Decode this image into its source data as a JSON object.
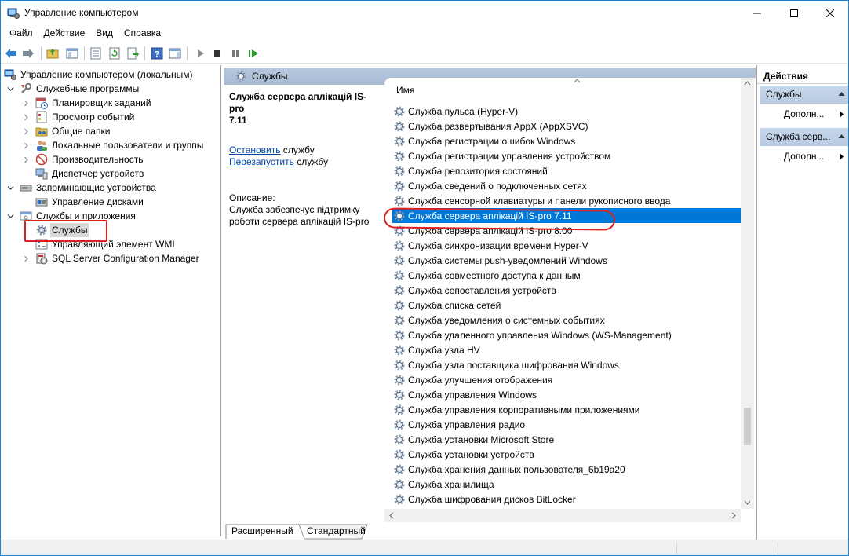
{
  "window": {
    "title": "Управление компьютером"
  },
  "menu": [
    "Файл",
    "Действие",
    "Вид",
    "Справка"
  ],
  "tree": {
    "root": "Управление компьютером (локальным)",
    "items": [
      {
        "label": "Служебные программы"
      },
      {
        "label": "Планировщик заданий"
      },
      {
        "label": "Просмотр событий"
      },
      {
        "label": "Общие папки"
      },
      {
        "label": "Локальные пользователи и группы"
      },
      {
        "label": "Производительность"
      },
      {
        "label": "Диспетчер устройств"
      },
      {
        "label": "Запоминающие устройства"
      },
      {
        "label": "Управление дисками"
      },
      {
        "label": "Службы и приложения"
      },
      {
        "label": "Службы"
      },
      {
        "label": "Управляющий элемент WMI"
      },
      {
        "label": "SQL Server Configuration Manager"
      }
    ]
  },
  "center": {
    "header": "Службы",
    "desc": {
      "title_line1": "Служба сервера аплікацій IS-pro",
      "title_line2": "7.11",
      "stop_link": "Остановить",
      "stop_rest": " службу",
      "restart_link": "Перезапустить",
      "restart_rest": " службу",
      "label": "Описание:",
      "text_line1": "Служба забезпечує підтримку",
      "text_line2": "роботи сервера аплікацій IS-pro"
    },
    "column_name": "Имя",
    "services": [
      "Служба пульса (Hyper-V)",
      "Служба развертывания AppX (AppXSVC)",
      "Служба регистрации ошибок Windows",
      "Служба регистрации управления устройством",
      "Служба репозитория состояний",
      "Служба сведений о подключенных сетях",
      "Служба сенсорной клавиатуры и панели рукописного ввода",
      "Служба сервера аплікацій IS-pro 7.11",
      "Служба сервера аплікацій IS-pro 8.00",
      "Служба синхронизации времени Hyper-V",
      "Служба системы push-уведомлений Windows",
      "Служба совместного доступа к данным",
      "Служба сопоставления устройств",
      "Служба списка сетей",
      "Служба уведомления о системных событиях",
      "Служба удаленного управления Windows (WS-Management)",
      "Служба узла HV",
      "Служба узла поставщика шифрования Windows",
      "Служба улучшения отображения",
      "Служба управления Windows",
      "Служба управления корпоративными приложениями",
      "Служба управления радио",
      "Служба установки Microsoft Store",
      "Служба установки устройств",
      "Служба хранения данных пользователя_6b19a20",
      "Служба хранилища",
      "Служба шифрования дисков BitLocker"
    ],
    "tabs": [
      "Расширенный",
      "Стандартный"
    ]
  },
  "actions": {
    "title": "Действия",
    "groups": [
      {
        "label": "Службы",
        "item": "Дополн..."
      },
      {
        "label": "Служба серв...",
        "item": "Дополн..."
      }
    ]
  },
  "colors": {
    "selection": "#0078d7",
    "header": "#b7c8dd",
    "highlight": "#e02020"
  }
}
